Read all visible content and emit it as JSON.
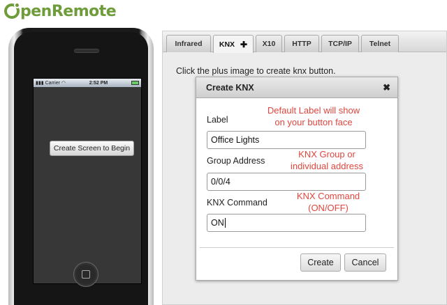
{
  "logo": {
    "text": "penRemote"
  },
  "phone": {
    "carrier": "Carrier",
    "time": "2:52 PM",
    "begin_button": "Create Screen to Begin"
  },
  "tabs": [
    {
      "label": "Infrared"
    },
    {
      "label": "KNX",
      "active": true,
      "icon": "plus-icon"
    },
    {
      "label": "X10"
    },
    {
      "label": "HTTP"
    },
    {
      "label": "TCP/IP"
    },
    {
      "label": "Telnet"
    }
  ],
  "hint": "Click the plus image to create knx button.",
  "dialog": {
    "title": "Create KNX",
    "label_field": {
      "label": "Label",
      "value": "Office Lights"
    },
    "group_field": {
      "label": "Group Address",
      "value": "0/0/4"
    },
    "command_field": {
      "label": "KNX Command",
      "value": "ON"
    },
    "create_label": "Create",
    "cancel_label": "Cancel"
  },
  "annotations": {
    "label_line1": "Default Label will show",
    "label_line2": "on your button face",
    "group_line1": "KNX Group or",
    "group_line2": "individual address",
    "command_line1": "KNX Command",
    "command_line2": "(ON/OFF)",
    "color": "#e0463e"
  },
  "colors": {
    "brand": "#6f9c3a"
  }
}
